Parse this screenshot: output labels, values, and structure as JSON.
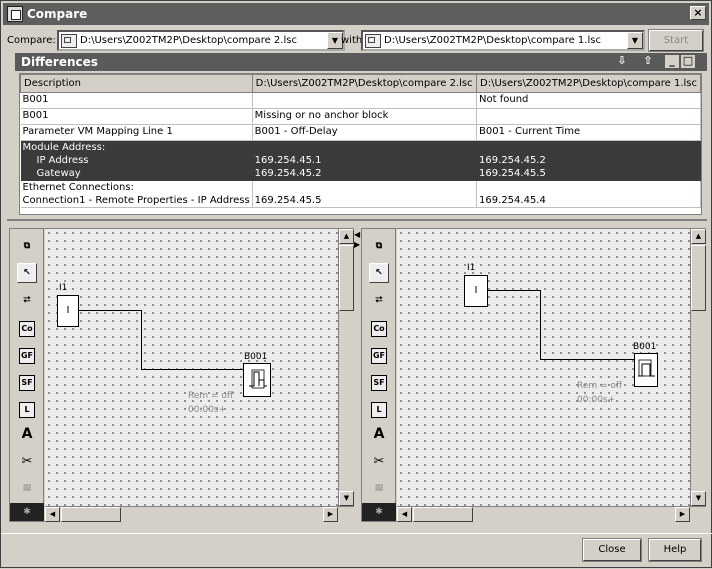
{
  "window": {
    "title": "Compare",
    "close_glyph": "×"
  },
  "compare": {
    "label": "Compare:",
    "file1": "D:\\Users\\Z002TM2P\\Desktop\\compare 2.lsc",
    "with_label": "with",
    "file2": "D:\\Users\\Z002TM2P\\Desktop\\compare 1.lsc",
    "start_label": "Start"
  },
  "differences": {
    "title": "Differences",
    "columns": [
      "Description",
      "D:\\Users\\Z002TM2P\\Desktop\\compare 2.lsc",
      "D:\\Users\\Z002TM2P\\Desktop\\compare 1.lsc"
    ],
    "rows": [
      {
        "desc": "B001",
        "a": "",
        "b": "Not found"
      },
      {
        "desc": "B001",
        "a": "Missing or no anchor block",
        "b": ""
      },
      {
        "desc": "Parameter VM Mapping Line 1",
        "a": "B001 - Off-Delay",
        "b": "B001 - Current Time"
      },
      {
        "desc": "Module Address:",
        "a": "",
        "b": ""
      },
      {
        "desc": "IP Address",
        "a": "169.254.45.1",
        "b": "169.254.45.2"
      },
      {
        "desc": "Gateway",
        "a": "169.254.45.2",
        "b": "169.254.45.5"
      },
      {
        "desc": "Ethernet Connections:",
        "a": "",
        "b": ""
      },
      {
        "desc": "Connection1 - Remote Properties - IP Address",
        "a": "169.254.45.5",
        "b": "169.254.45.4"
      }
    ]
  },
  "toolbar": {
    "co": "Co",
    "gf": "GF",
    "sf": "SF",
    "l": "L",
    "a": "A"
  },
  "left_diagram": {
    "input_name": "I1",
    "input_text": "I",
    "block_name": "B001",
    "rem": "Rem = off",
    "time": "00:00s+"
  },
  "right_diagram": {
    "input_name": "I1",
    "input_text": "I",
    "block_name": "B001",
    "rem": "Rem = off",
    "time": "00:00s+"
  },
  "footer": {
    "close_label": "Close",
    "help_label": "Help"
  }
}
